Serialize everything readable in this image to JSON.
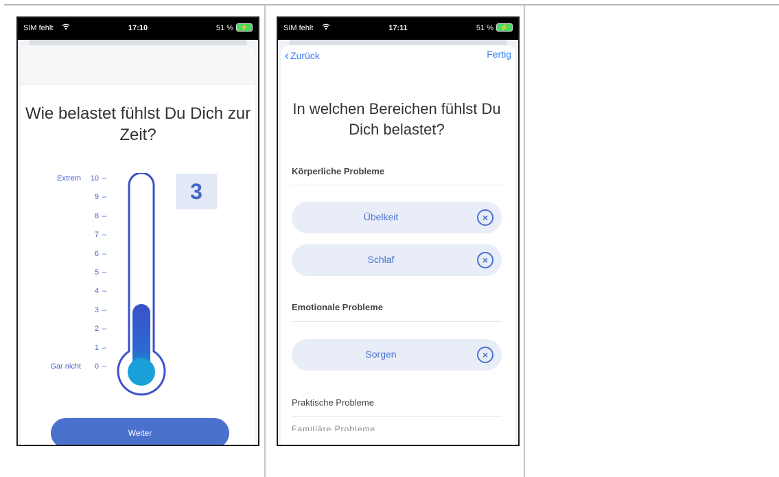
{
  "status_left": {
    "carrier": "SIM fehlt",
    "time": "17:10",
    "battery": "51 %"
  },
  "status_right": {
    "carrier": "SIM fehlt",
    "time": "17:11",
    "battery": "51 %"
  },
  "distress_screen": {
    "question": "Wie belastet fühlst Du Dich zur Zeit?",
    "scale": {
      "max_label": "Extrem",
      "min_label": "Gar nicht",
      "ticks": [
        "10",
        "9",
        "8",
        "7",
        "6",
        "5",
        "4",
        "3",
        "2",
        "1",
        "0"
      ],
      "min": 0,
      "max": 10
    },
    "value": 3,
    "value_display": "3",
    "continue_label": "Weiter"
  },
  "problem_screen": {
    "back_label": "Zurück",
    "done_label": "Fertig",
    "question": "In welchen Bereichen fühlst Du Dich belastet?",
    "sections": [
      {
        "title": "Körperliche Probleme",
        "chips": [
          "Übelkeit",
          "Schlaf"
        ]
      },
      {
        "title": "Emotionale Probleme",
        "chips": [
          "Sorgen"
        ]
      },
      {
        "title": "Praktische Probleme",
        "chips": []
      }
    ],
    "next_section_partial": "Familiäre Probleme"
  },
  "colors": {
    "accent": "#4a71cc",
    "thermometer_fill_top": "#3a52c8",
    "thermometer_fill_bottom": "#1aa0d8",
    "link": "#3b82f6"
  },
  "icons": {
    "wifi": "wifi-icon",
    "battery": "battery-icon",
    "back": "chevron-left-icon",
    "remove": "close-circle-icon"
  }
}
